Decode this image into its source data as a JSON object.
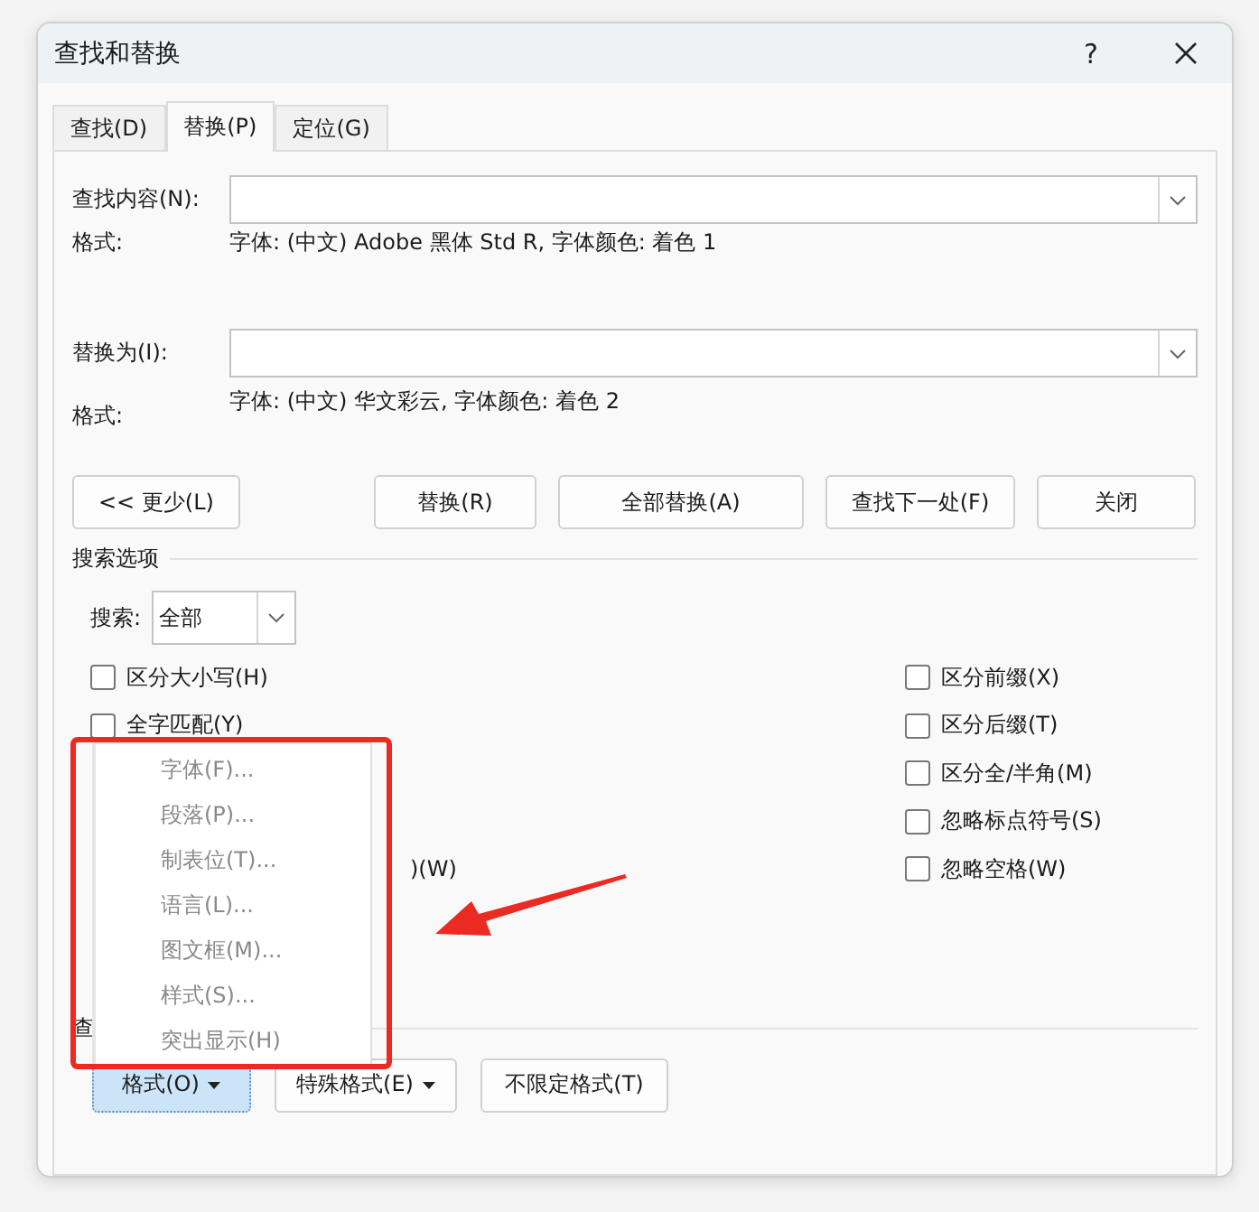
{
  "window": {
    "title": "查找和替换",
    "help": "?"
  },
  "tabs": [
    {
      "label": "查找(D)",
      "selected": false
    },
    {
      "label": "替换(P)",
      "selected": true
    },
    {
      "label": "定位(G)",
      "selected": false
    }
  ],
  "find": {
    "label": "查找内容(N):",
    "format_label": "格式:",
    "format_value": "字体: (中文) Adobe 黑体 Std R, 字体颜色: 着色 1"
  },
  "replace": {
    "label": "替换为(I):",
    "format_label": "格式:",
    "format_value": "字体: (中文) 华文彩云, 字体颜色: 着色 2"
  },
  "buttons": [
    {
      "label": "<< 更少(L)"
    },
    {
      "label": "替换(R)"
    },
    {
      "label": "全部替换(A)"
    },
    {
      "label": "查找下一处(F)"
    },
    {
      "label": "关闭"
    }
  ],
  "search_options": {
    "title": "搜索选项",
    "search_label": "搜索:",
    "search_value": "全部",
    "left": [
      {
        "kind": "checkbox",
        "label": "区分大小写(H)",
        "checked": false
      },
      {
        "kind": "checkbox",
        "label": "全字匹配(Y)",
        "checked": false
      },
      {
        "kind": "fragment",
        "label": ")(W)"
      }
    ],
    "right": [
      {
        "kind": "checkbox",
        "label": "区分前缀(X)",
        "checked": false
      },
      {
        "kind": "checkbox",
        "label": "区分后缀(T)",
        "checked": false
      },
      {
        "kind": "checkbox",
        "label": "区分全/半角(M)",
        "checked": false
      },
      {
        "kind": "checkbox",
        "label": "忽略标点符号(S)",
        "checked": false
      },
      {
        "kind": "checkbox",
        "label": "忽略空格(W)",
        "checked": false
      }
    ]
  },
  "find_section": {
    "title": "查",
    "buttons": [
      {
        "label": "格式(O)",
        "dropdown": true,
        "selected": true
      },
      {
        "label": "特殊格式(E)",
        "dropdown": true,
        "selected": false
      },
      {
        "label": "不限定格式(T)",
        "dropdown": false,
        "selected": false
      }
    ]
  },
  "format_menu": {
    "items": [
      {
        "label": "字体(F)...",
        "disabled": true
      },
      {
        "label": "段落(P)...",
        "disabled": true
      },
      {
        "label": "制表位(T)...",
        "disabled": true
      },
      {
        "label": "语言(L)...",
        "disabled": true
      },
      {
        "label": "图文框(M)...",
        "disabled": true
      },
      {
        "label": "样式(S)...",
        "disabled": true
      },
      {
        "label": "突出显示(H)",
        "disabled": true
      }
    ]
  }
}
